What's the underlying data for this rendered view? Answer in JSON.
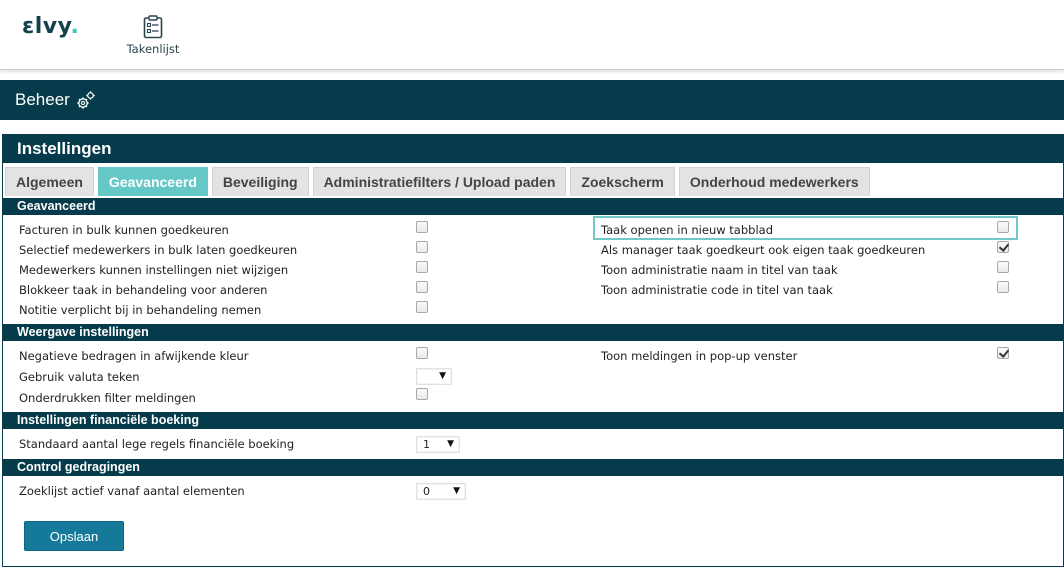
{
  "app": {
    "logo_text": "ɛlvy",
    "logo_dot": "."
  },
  "nav": {
    "tasklist_label": "Takenlijst",
    "tasklist_icon": "clipboard-list-icon"
  },
  "header": {
    "title": "Beheer",
    "icon": "gears-icon"
  },
  "panel": {
    "title": "Instellingen",
    "tabs": [
      {
        "label": "Algemeen",
        "active": false
      },
      {
        "label": "Geavanceerd",
        "active": true
      },
      {
        "label": "Beveiliging",
        "active": false
      },
      {
        "label": "Administratiefilters / Upload paden",
        "active": false
      },
      {
        "label": "Zoekscherm",
        "active": false
      },
      {
        "label": "Onderhoud medewerkers",
        "active": false
      }
    ]
  },
  "sections": {
    "advanced": {
      "title": "Geavanceerd",
      "left": [
        {
          "label": "Facturen in bulk kunnen goedkeuren",
          "checked": false
        },
        {
          "label": "Selectief medewerkers in bulk laten goedkeuren",
          "checked": false
        },
        {
          "label": "Medewerkers kunnen instellingen niet wijzigen",
          "checked": false
        },
        {
          "label": "Blokkeer taak in behandeling voor anderen",
          "checked": false
        },
        {
          "label": "Notitie verplicht bij in behandeling nemen",
          "checked": false
        }
      ],
      "right": [
        {
          "label": "Taak openen in nieuw tabblad",
          "checked": false
        },
        {
          "label": "Als manager taak goedkeurt ook eigen taak goedkeuren",
          "checked": true
        },
        {
          "label": "Toon administratie naam in titel van taak",
          "checked": false
        },
        {
          "label": "Toon administratie code in titel van taak",
          "checked": false
        }
      ]
    },
    "display": {
      "title": "Weergave instellingen",
      "negative_label": "Negatieve bedragen in afwijkende kleur",
      "negative_checked": false,
      "currency_label": "Gebruik valuta teken",
      "currency_value": "",
      "suppress_label": "Onderdrukken filter meldingen",
      "suppress_checked": false,
      "popup_label": "Toon meldingen in pop-up venster",
      "popup_checked": true
    },
    "financial": {
      "title": "Instellingen financiële boeking",
      "empty_rows_label": "Standaard aantal lege regels financiële boeking",
      "empty_rows_value": "1"
    },
    "control": {
      "title": "Control gedragingen",
      "search_list_label": "Zoeklijst actief vanaf aantal elementen",
      "search_list_value": "0"
    }
  },
  "actions": {
    "save_label": "Opslaan"
  },
  "colors": {
    "primary": "#063b4c",
    "accent": "#66c8c6",
    "button": "#157a99"
  }
}
